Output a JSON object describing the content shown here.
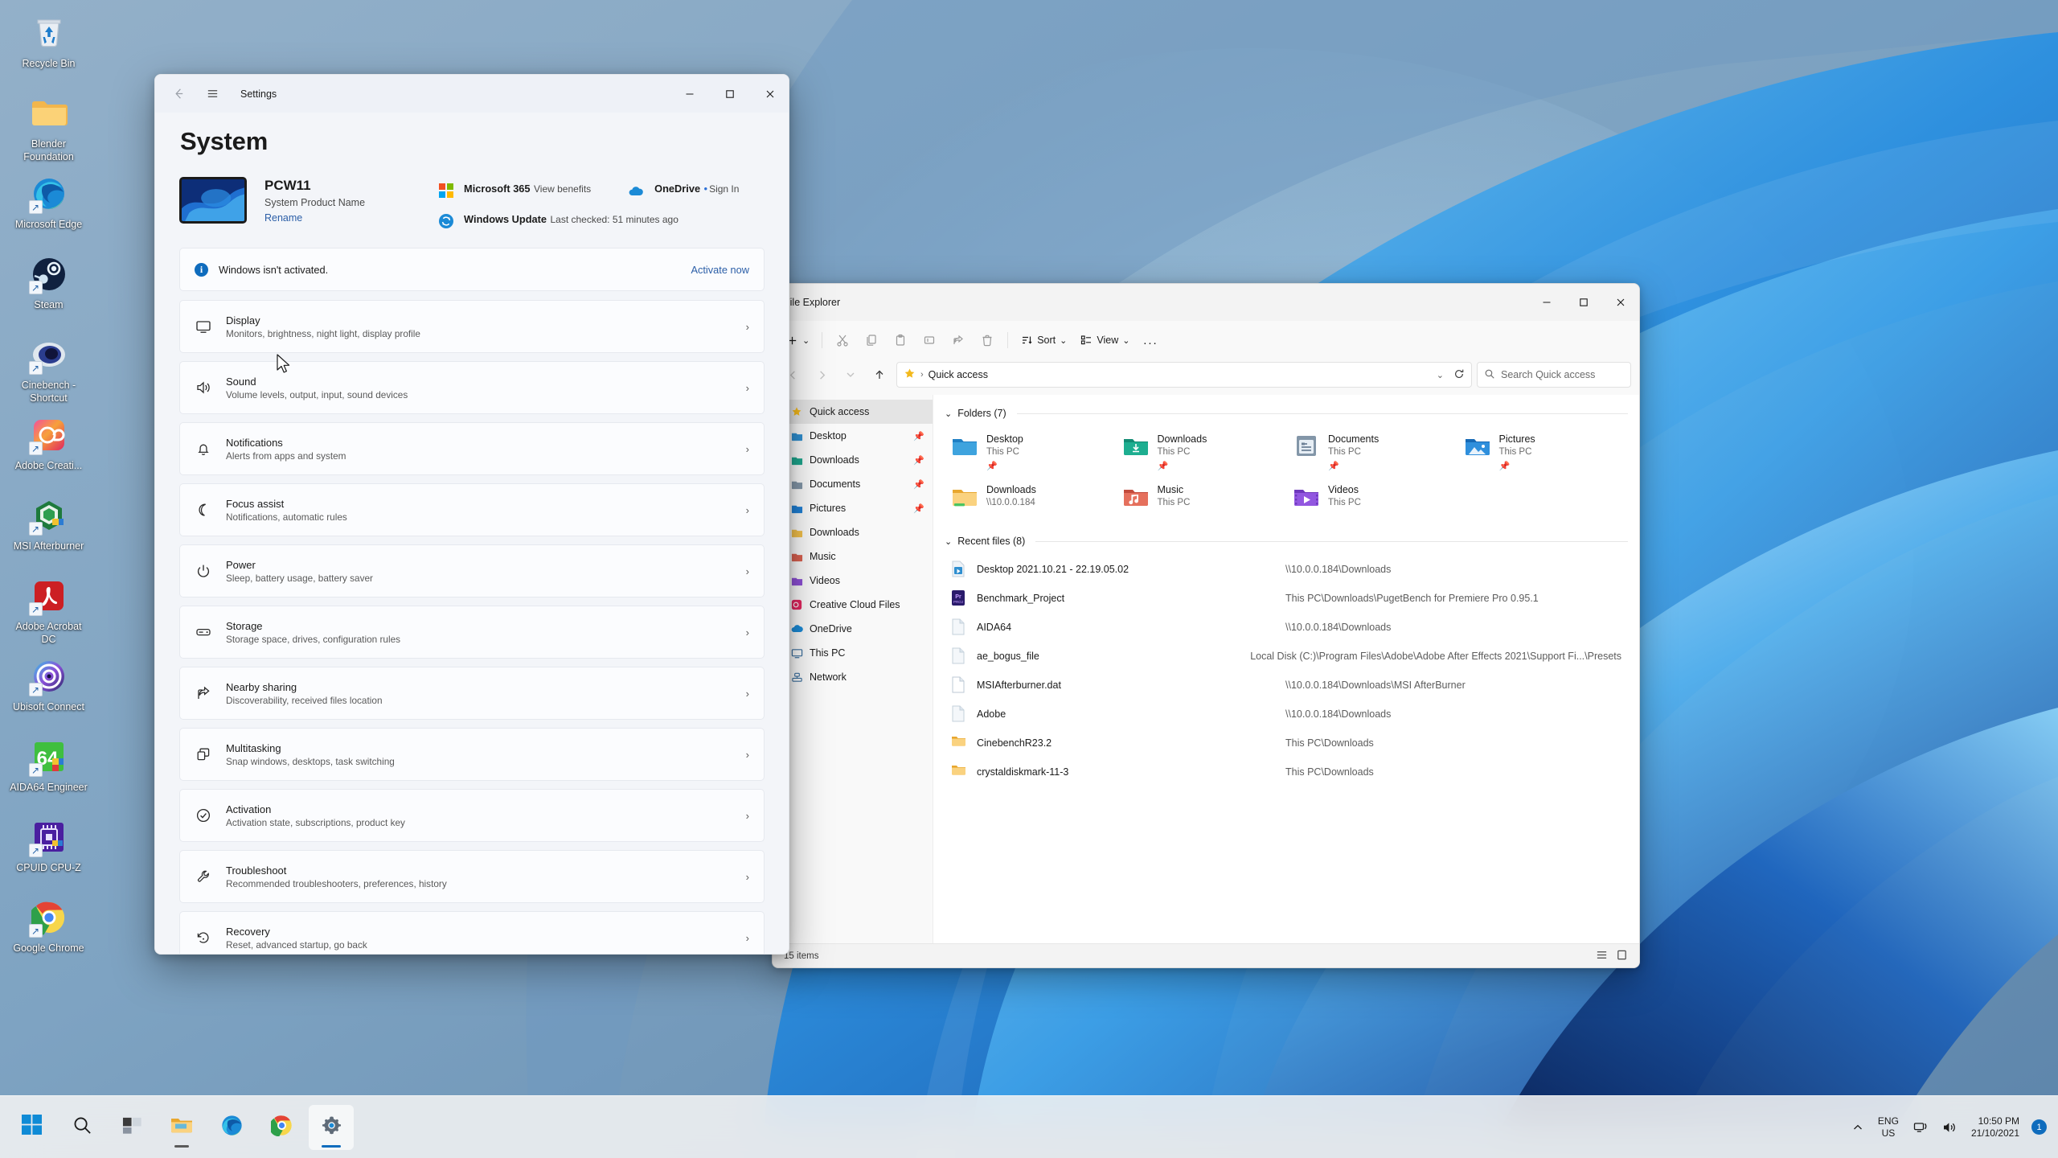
{
  "desktop": {
    "icons": [
      {
        "label": "Recycle Bin",
        "icon": "recycle-bin-icon",
        "shortcut": false
      },
      {
        "label": "Blender Foundation",
        "icon": "folder-icon",
        "shortcut": false
      },
      {
        "label": "Microsoft Edge",
        "icon": "edge-icon",
        "shortcut": true
      },
      {
        "label": "Steam",
        "icon": "steam-icon",
        "shortcut": true
      },
      {
        "label": "Cinebench - Shortcut",
        "icon": "cinebench-icon",
        "shortcut": true
      },
      {
        "label": "Adobe Creati...",
        "icon": "adobe-creative-cloud-icon",
        "shortcut": true
      },
      {
        "label": "MSI Afterburner",
        "icon": "msi-afterburner-icon",
        "shortcut": true
      },
      {
        "label": "Adobe Acrobat DC",
        "icon": "adobe-acrobat-icon",
        "shortcut": true
      },
      {
        "label": "Ubisoft Connect",
        "icon": "ubisoft-connect-icon",
        "shortcut": true
      },
      {
        "label": "AIDA64 Engineer",
        "icon": "aida64-icon",
        "shortcut": true
      },
      {
        "label": "CPUID CPU-Z",
        "icon": "cpuz-icon",
        "shortcut": true
      },
      {
        "label": "Google Chrome",
        "icon": "chrome-icon",
        "shortcut": true
      }
    ]
  },
  "settings": {
    "window_title": "Settings",
    "back_icon": "back-arrow-icon",
    "menu_icon": "hamburger-menu-icon",
    "minimize_icon": "minimize-icon",
    "maximize_icon": "maximize-icon",
    "close_icon": "close-icon",
    "page_title": "System",
    "device": {
      "name": "PCW11",
      "product": "System Product Name",
      "rename_label": "Rename"
    },
    "services": [
      {
        "title": "Microsoft 365",
        "sub": "View benefits",
        "icon": "microsoft-365-icon",
        "link": false
      },
      {
        "title": "OneDrive",
        "sub": "Sign In",
        "icon": "onedrive-icon",
        "link": false,
        "dot": true
      },
      {
        "title": "Windows Update",
        "sub": "Last checked: 51 minutes ago",
        "icon": "windows-update-icon",
        "link": false
      }
    ],
    "activation": {
      "message": "Windows isn't activated.",
      "action_label": "Activate now",
      "info_icon": "info-icon"
    },
    "rows": [
      {
        "title": "Display",
        "sub": "Monitors, brightness, night light, display profile",
        "icon": "monitor-icon"
      },
      {
        "title": "Sound",
        "sub": "Volume levels, output, input, sound devices",
        "icon": "speaker-icon"
      },
      {
        "title": "Notifications",
        "sub": "Alerts from apps and system",
        "icon": "bell-icon"
      },
      {
        "title": "Focus assist",
        "sub": "Notifications, automatic rules",
        "icon": "moon-icon"
      },
      {
        "title": "Power",
        "sub": "Sleep, battery usage, battery saver",
        "icon": "power-icon"
      },
      {
        "title": "Storage",
        "sub": "Storage space, drives, configuration rules",
        "icon": "drive-icon"
      },
      {
        "title": "Nearby sharing",
        "sub": "Discoverability, received files location",
        "icon": "share-icon"
      },
      {
        "title": "Multitasking",
        "sub": "Snap windows, desktops, task switching",
        "icon": "multitask-icon"
      },
      {
        "title": "Activation",
        "sub": "Activation state, subscriptions, product key",
        "icon": "check-circle-icon"
      },
      {
        "title": "Troubleshoot",
        "sub": "Recommended troubleshooters, preferences, history",
        "icon": "wrench-icon"
      },
      {
        "title": "Recovery",
        "sub": "Reset, advanced startup, go back",
        "icon": "recovery-icon"
      }
    ]
  },
  "explorer": {
    "window_title": "File Explorer",
    "minimize_icon": "minimize-icon",
    "maximize_icon": "maximize-icon",
    "close_icon": "close-icon",
    "toolbar": {
      "new_label": "New",
      "cut_icon": "cut-icon",
      "copy_icon": "copy-icon",
      "paste_icon": "paste-icon",
      "rename_icon": "rename-icon",
      "share_icon": "share-icon",
      "delete_icon": "trash-icon",
      "sort_label": "Sort",
      "sort_icon": "sort-icon",
      "view_label": "View",
      "view_icon": "view-icon",
      "more_label": "...",
      "more_icon": "ellipsis-icon"
    },
    "nav_buttons": {
      "back_icon": "back-arrow-icon",
      "forward_icon": "forward-arrow-icon",
      "recent_icon": "chevron-down-icon",
      "up_icon": "up-arrow-icon",
      "refresh_icon": "refresh-icon"
    },
    "address": {
      "location_icon": "star-icon",
      "crumb": "Quick access",
      "dropdown_icon": "chevron-down-icon"
    },
    "search": {
      "placeholder": "Search Quick access",
      "icon": "search-icon"
    },
    "sidebar": [
      {
        "label": "Quick access",
        "icon": "star-icon",
        "pinned": false,
        "selected": true
      },
      {
        "label": "Desktop",
        "icon": "desktop-folder-icon",
        "pinned": true,
        "selected": false
      },
      {
        "label": "Downloads",
        "icon": "downloads-folder-icon",
        "pinned": true,
        "selected": false
      },
      {
        "label": "Documents",
        "icon": "documents-folder-icon",
        "pinned": true,
        "selected": false
      },
      {
        "label": "Pictures",
        "icon": "pictures-folder-icon",
        "pinned": true,
        "selected": false
      },
      {
        "label": "Downloads",
        "icon": "network-folder-icon",
        "pinned": false,
        "selected": false
      },
      {
        "label": "Music",
        "icon": "music-folder-icon",
        "pinned": false,
        "selected": false
      },
      {
        "label": "Videos",
        "icon": "videos-folder-icon",
        "pinned": false,
        "selected": false
      },
      {
        "label": "Creative Cloud Files",
        "icon": "creative-cloud-icon",
        "pinned": false,
        "selected": false
      },
      {
        "label": "OneDrive",
        "icon": "onedrive-icon",
        "pinned": false,
        "selected": false
      },
      {
        "label": "This PC",
        "icon": "this-pc-icon",
        "pinned": false,
        "selected": false
      },
      {
        "label": "Network",
        "icon": "network-icon",
        "pinned": false,
        "selected": false
      }
    ],
    "folders_group": {
      "label": "Folders (7)",
      "expand_icon": "chevron-down-icon",
      "items": [
        {
          "name": "Desktop",
          "sub": "This PC",
          "icon": "desktop-folder-icon",
          "pinned": true
        },
        {
          "name": "Downloads",
          "sub": "This PC",
          "icon": "downloads-folder-icon",
          "pinned": true
        },
        {
          "name": "Documents",
          "sub": "This PC",
          "icon": "documents-folder-icon",
          "pinned": true
        },
        {
          "name": "Pictures",
          "sub": "This PC",
          "icon": "pictures-folder-icon",
          "pinned": true
        },
        {
          "name": "Downloads",
          "sub": "\\\\10.0.0.184",
          "icon": "network-folder-icon",
          "pinned": false
        },
        {
          "name": "Music",
          "sub": "This PC",
          "icon": "music-folder-icon",
          "pinned": false
        },
        {
          "name": "Videos",
          "sub": "This PC",
          "icon": "videos-folder-icon",
          "pinned": false
        }
      ]
    },
    "recent_group": {
      "label": "Recent files (8)",
      "expand_icon": "chevron-down-icon",
      "items": [
        {
          "name": "Desktop 2021.10.21 - 22.19.05.02",
          "path": "\\\\10.0.0.184\\Downloads",
          "icon": "video-file-icon"
        },
        {
          "name": "Benchmark_Project",
          "path": "This PC\\Downloads\\PugetBench for Premiere Pro 0.95.1",
          "icon": "premiere-file-icon"
        },
        {
          "name": "AIDA64",
          "path": "\\\\10.0.0.184\\Downloads",
          "icon": "generic-file-icon"
        },
        {
          "name": "ae_bogus_file",
          "path": "Local Disk (C:)\\Program Files\\Adobe\\Adobe After Effects 2021\\Support Fi...\\Presets",
          "icon": "generic-file-icon"
        },
        {
          "name": "MSIAfterburner.dat",
          "path": "\\\\10.0.0.184\\Downloads\\MSI AfterBurner",
          "icon": "dat-file-icon"
        },
        {
          "name": "Adobe",
          "path": "\\\\10.0.0.184\\Downloads",
          "icon": "generic-file-icon"
        },
        {
          "name": "CinebenchR23.2",
          "path": "This PC\\Downloads",
          "icon": "folder-small-icon"
        },
        {
          "name": "crystaldiskmark-11-3",
          "path": "This PC\\Downloads",
          "icon": "folder-small-icon"
        }
      ]
    },
    "status": {
      "item_count": "15 items",
      "list_view_icon": "list-view-icon",
      "details_view_icon": "details-view-icon"
    }
  },
  "taskbar": {
    "apps": [
      {
        "name": "start-button",
        "icon": "windows-logo-icon",
        "active": false,
        "running": false
      },
      {
        "name": "search-button",
        "icon": "search-icon",
        "active": false,
        "running": false
      },
      {
        "name": "task-view-button",
        "icon": "task-view-icon",
        "active": false,
        "running": false
      },
      {
        "name": "file-explorer-button",
        "icon": "file-explorer-icon",
        "active": false,
        "running": true
      },
      {
        "name": "edge-button",
        "icon": "edge-icon",
        "active": false,
        "running": false
      },
      {
        "name": "chrome-button",
        "icon": "chrome-icon",
        "active": false,
        "running": false
      },
      {
        "name": "settings-button",
        "icon": "gear-icon",
        "active": true,
        "running": true
      }
    ],
    "tray": {
      "chevron_icon": "chevron-up-icon",
      "language_top": "ENG",
      "language_bottom": "US",
      "network_icon": "network-icon",
      "volume_icon": "volume-icon",
      "time": "10:50 PM",
      "date": "21/10/2021",
      "notification_count": "1"
    }
  },
  "colors": {
    "accent": "#0f6cbd",
    "link": "#2b5ea7",
    "desktop": "#6f94b5",
    "settings_bg": "#f3f5f9"
  }
}
